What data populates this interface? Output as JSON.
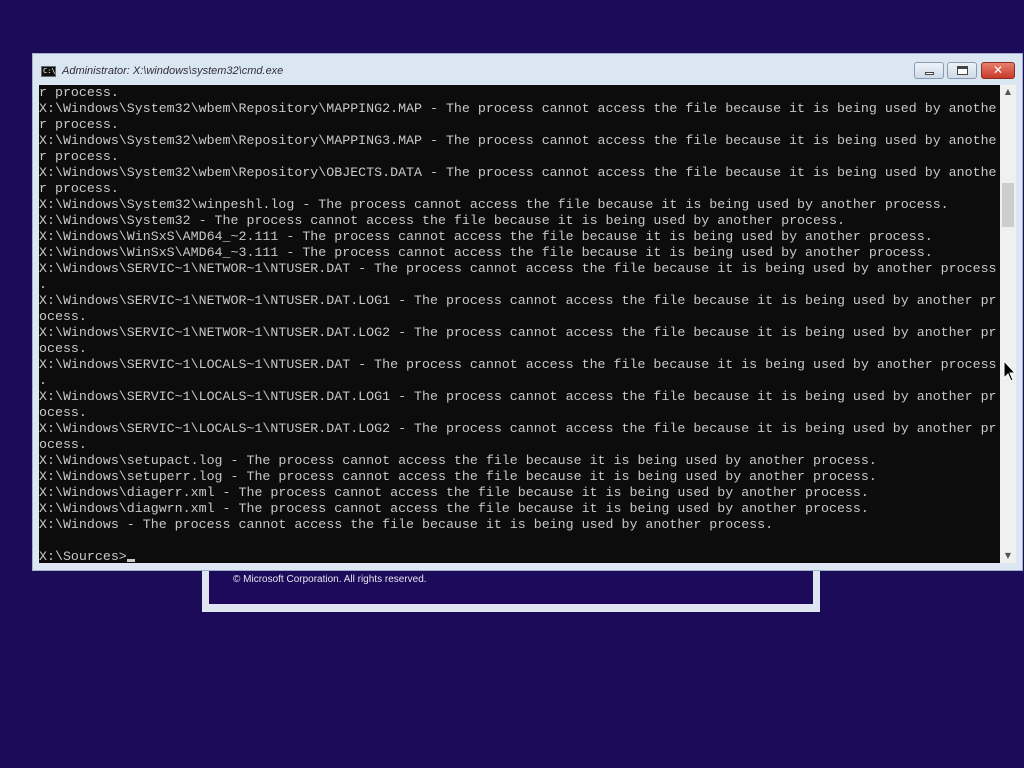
{
  "window": {
    "title": "Administrator: X:\\windows\\system32\\cmd.exe",
    "icon_label": "C:\\",
    "controls": {
      "minimize": "minimize-icon",
      "maximize": "maximize-icon",
      "close": "✕"
    }
  },
  "console": {
    "lines": [
      "r process.",
      "X:\\Windows\\System32\\wbem\\Repository\\MAPPING2.MAP - The process cannot access the file because it is being used by anothe",
      "r process.",
      "X:\\Windows\\System32\\wbem\\Repository\\MAPPING3.MAP - The process cannot access the file because it is being used by anothe",
      "r process.",
      "X:\\Windows\\System32\\wbem\\Repository\\OBJECTS.DATA - The process cannot access the file because it is being used by anothe",
      "r process.",
      "X:\\Windows\\System32\\winpeshl.log - The process cannot access the file because it is being used by another process.",
      "X:\\Windows\\System32 - The process cannot access the file because it is being used by another process.",
      "X:\\Windows\\WinSxS\\AMD64_~2.111 - The process cannot access the file because it is being used by another process.",
      "X:\\Windows\\WinSxS\\AMD64_~3.111 - The process cannot access the file because it is being used by another process.",
      "X:\\Windows\\SERVIC~1\\NETWOR~1\\NTUSER.DAT - The process cannot access the file because it is being used by another process",
      ".",
      "X:\\Windows\\SERVIC~1\\NETWOR~1\\NTUSER.DAT.LOG1 - The process cannot access the file because it is being used by another pr",
      "ocess.",
      "X:\\Windows\\SERVIC~1\\NETWOR~1\\NTUSER.DAT.LOG2 - The process cannot access the file because it is being used by another pr",
      "ocess.",
      "X:\\Windows\\SERVIC~1\\LOCALS~1\\NTUSER.DAT - The process cannot access the file because it is being used by another process",
      ".",
      "X:\\Windows\\SERVIC~1\\LOCALS~1\\NTUSER.DAT.LOG1 - The process cannot access the file because it is being used by another pr",
      "ocess.",
      "X:\\Windows\\SERVIC~1\\LOCALS~1\\NTUSER.DAT.LOG2 - The process cannot access the file because it is being used by another pr",
      "ocess.",
      "X:\\Windows\\setupact.log - The process cannot access the file because it is being used by another process.",
      "X:\\Windows\\setuperr.log - The process cannot access the file because it is being used by another process.",
      "X:\\Windows\\diagerr.xml - The process cannot access the file because it is being used by another process.",
      "X:\\Windows\\diagwrn.xml - The process cannot access the file because it is being used by another process.",
      "X:\\Windows - The process cannot access the file because it is being used by another process.",
      ""
    ],
    "prompt": "X:\\Sources>"
  },
  "scrollbar": {
    "up_icon": "scroll-up-arrow-icon",
    "down_icon": "scroll-down-arrow-icon"
  },
  "background_dialog": {
    "copyright": "© Microsoft Corporation. All rights reserved."
  },
  "colors": {
    "desktop": "#1b0b58",
    "console_bg": "#0c0c0c",
    "console_text": "#c8c8c8",
    "close_button": "#c8392a"
  }
}
